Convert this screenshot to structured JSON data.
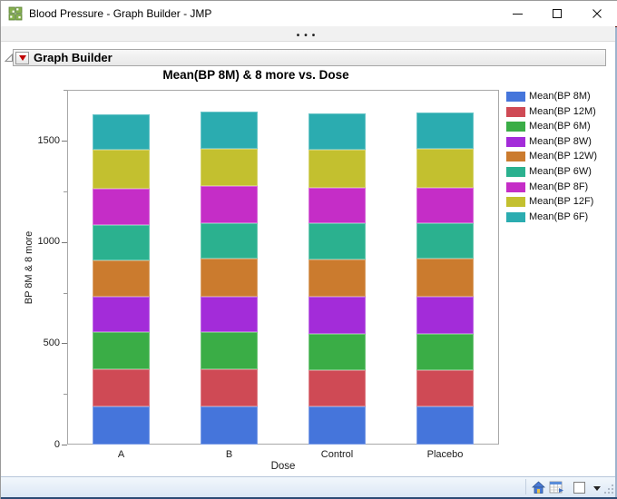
{
  "window": {
    "title": "Blood Pressure - Graph Builder - JMP",
    "app_icon": "jmp-grid-icon",
    "controls": [
      "minimize",
      "maximize",
      "close"
    ]
  },
  "toolbar": {
    "overflow_dots": "•••"
  },
  "report": {
    "outline_title": "Graph Builder",
    "red_triangle_menu": "red-triangle-icon",
    "disclosure": "collapse-triangle-icon"
  },
  "chart_data": {
    "type": "bar",
    "stacked": true,
    "title": "Mean(BP 8M) & 8 more vs. Dose",
    "xlabel": "Dose",
    "ylabel": "BP 8M & 8 more",
    "categories": [
      "A",
      "B",
      "Control",
      "Placebo"
    ],
    "series": [
      {
        "name": "Mean(BP 8M)",
        "color": "#4575DB",
        "values": [
          186,
          190,
          187,
          190
        ]
      },
      {
        "name": "Mean(BP 12M)",
        "color": "#CF4A55",
        "values": [
          185,
          180,
          181,
          177
        ]
      },
      {
        "name": "Mean(BP 6M)",
        "color": "#3AAD46",
        "values": [
          183,
          185,
          180,
          178
        ]
      },
      {
        "name": "Mean(BP 8W)",
        "color": "#A32CD9",
        "values": [
          177,
          176,
          183,
          183
        ]
      },
      {
        "name": "Mean(BP 12W)",
        "color": "#CB7B2E",
        "values": [
          180,
          185,
          183,
          188
        ]
      },
      {
        "name": "Mean(BP 6W)",
        "color": "#2BB18F",
        "values": [
          173,
          176,
          177,
          176
        ]
      },
      {
        "name": "Mean(BP 8F)",
        "color": "#C52DC7",
        "values": [
          180,
          185,
          177,
          174
        ]
      },
      {
        "name": "Mean(BP 12F)",
        "color": "#C3C02F",
        "values": [
          190,
          183,
          187,
          195
        ]
      },
      {
        "name": "Mean(BP 6F)",
        "color": "#2BACB0",
        "values": [
          176,
          183,
          180,
          179
        ]
      }
    ],
    "ylim": [
      0,
      1750
    ],
    "y_major_ticks": [
      0,
      500,
      1000,
      1500
    ],
    "y_minor_ticks": [
      250,
      750,
      1250,
      1750
    ],
    "grid": false,
    "legend_position": "right"
  },
  "statusbar": {
    "icons": [
      "home-icon",
      "data-table-icon",
      "color-swatch",
      "dropdown-icon",
      "resize-grip-icon"
    ]
  }
}
